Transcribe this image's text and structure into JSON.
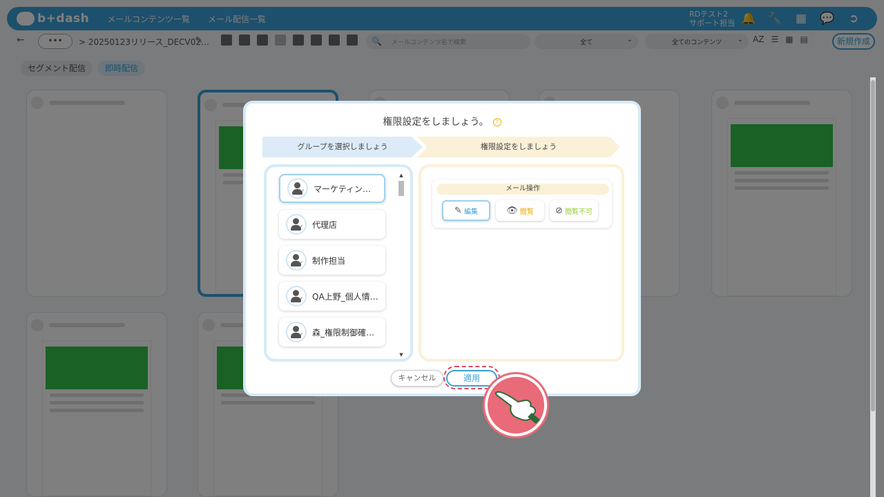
{
  "header": {
    "logo_text": "b+dash",
    "nav": [
      "メールコンテンツ一覧",
      "メール配信一覧"
    ],
    "user": {
      "line1": "RDテスト2",
      "line2": "サポート担当"
    },
    "icons": [
      "bell-icon",
      "wrench-icon",
      "grid-icon",
      "chat-icon",
      "logout-icon"
    ]
  },
  "toolbar": {
    "back": "←",
    "more": "•••",
    "path": "> 20250123リリース_DECV02…",
    "search_placeholder": "メールコンテンツ名で検索",
    "filter1": "全て",
    "filter2": "全てのコンテンツ",
    "sort_label": "AZ",
    "new_button": "新規作成"
  },
  "tabs": [
    "セグメント配信",
    "即時配信"
  ],
  "modal": {
    "title": "権限設定をしましょう。",
    "help": "?",
    "step1": "グループを選択しましょう",
    "step2": "権限設定をしましょう",
    "groups": [
      "マーケティン…",
      "代理店",
      "制作担当",
      "QA上野_個人情…",
      "森_権限制御確…"
    ],
    "permission": {
      "label": "メール操作",
      "buttons": [
        {
          "label": "編集",
          "icon": "pencil-icon"
        },
        {
          "label": "閲覧",
          "icon": "eye-icon"
        },
        {
          "label": "閲覧不可",
          "icon": "no-view-icon"
        }
      ]
    },
    "cancel": "キャンセル",
    "apply": "適用"
  },
  "colors": {
    "primary": "#3aa0d8",
    "step2_bg": "#fbf1d8",
    "highlight": "#e0485f",
    "hand_bg": "#e96a78"
  }
}
